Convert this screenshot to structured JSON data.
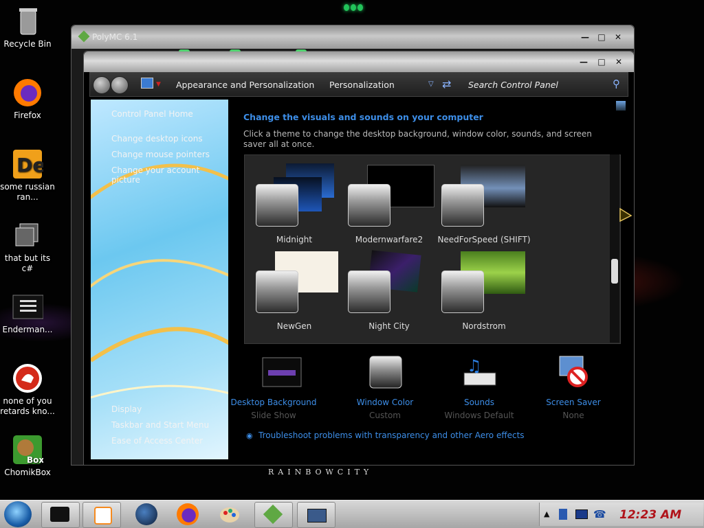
{
  "desktop": {
    "icons": [
      {
        "label": "Recycle Bin"
      },
      {
        "label": "Firefox"
      },
      {
        "label": "some russian ran..."
      },
      {
        "label": "that but its c#"
      },
      {
        "label": "Enderman..."
      },
      {
        "label": "none of you retards kno..."
      },
      {
        "label": "ChomikBox"
      }
    ]
  },
  "back_window": {
    "title": "PolyMC 6.1"
  },
  "control_panel": {
    "breadcrumb": [
      "Appearance and Personalization",
      "Personalization"
    ],
    "search_placeholder": "Search Control Panel",
    "sidebar": {
      "home": "Control Panel Home",
      "links": [
        "Change desktop icons",
        "Change mouse pointers",
        "Change your account picture"
      ],
      "see_also": [
        "Display",
        "Taskbar and Start Menu",
        "Ease of Access Center"
      ]
    },
    "heading": "Change the visuals and sounds on your computer",
    "description": "Click a theme to change the desktop background, window color, sounds, and screen saver all at once.",
    "themes": [
      {
        "name": "Midnight"
      },
      {
        "name": "Modernwarfare2"
      },
      {
        "name": "NeedForSpeed (SHIFT)"
      },
      {
        "name": "NewGen"
      },
      {
        "name": "Night City"
      },
      {
        "name": "Nordstrom"
      }
    ],
    "bottom": [
      {
        "title": "Desktop Background",
        "sub": "Slide Show"
      },
      {
        "title": "Window Color",
        "sub": "Custom"
      },
      {
        "title": "Sounds",
        "sub": "Windows Default"
      },
      {
        "title": "Screen Saver",
        "sub": "None"
      }
    ],
    "troubleshoot": "Troubleshoot problems with transparency and other Aero effects"
  },
  "wallpaper_logo": "RAINBOWCITY",
  "taskbar": {
    "clock": "12:23 AM"
  },
  "colors": {
    "link": "#3d8ee8",
    "clock": "#b0131a"
  }
}
